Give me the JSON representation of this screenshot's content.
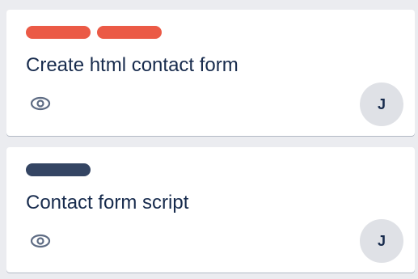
{
  "colors": {
    "background": "#ebecf0",
    "card": "#ffffff",
    "label_red": "#eb5a46",
    "label_navy": "#344563",
    "text": "#172b4d",
    "icon": "#5e6c84",
    "avatar_bg": "#dfe1e6"
  },
  "cards": [
    {
      "title": "Create html contact form",
      "labels": [
        "label_red",
        "label_red"
      ],
      "badge_icon": "eye-icon",
      "member_initial": "J"
    },
    {
      "title": "Contact form script",
      "labels": [
        "label_navy"
      ],
      "badge_icon": "eye-icon",
      "member_initial": "J"
    }
  ]
}
